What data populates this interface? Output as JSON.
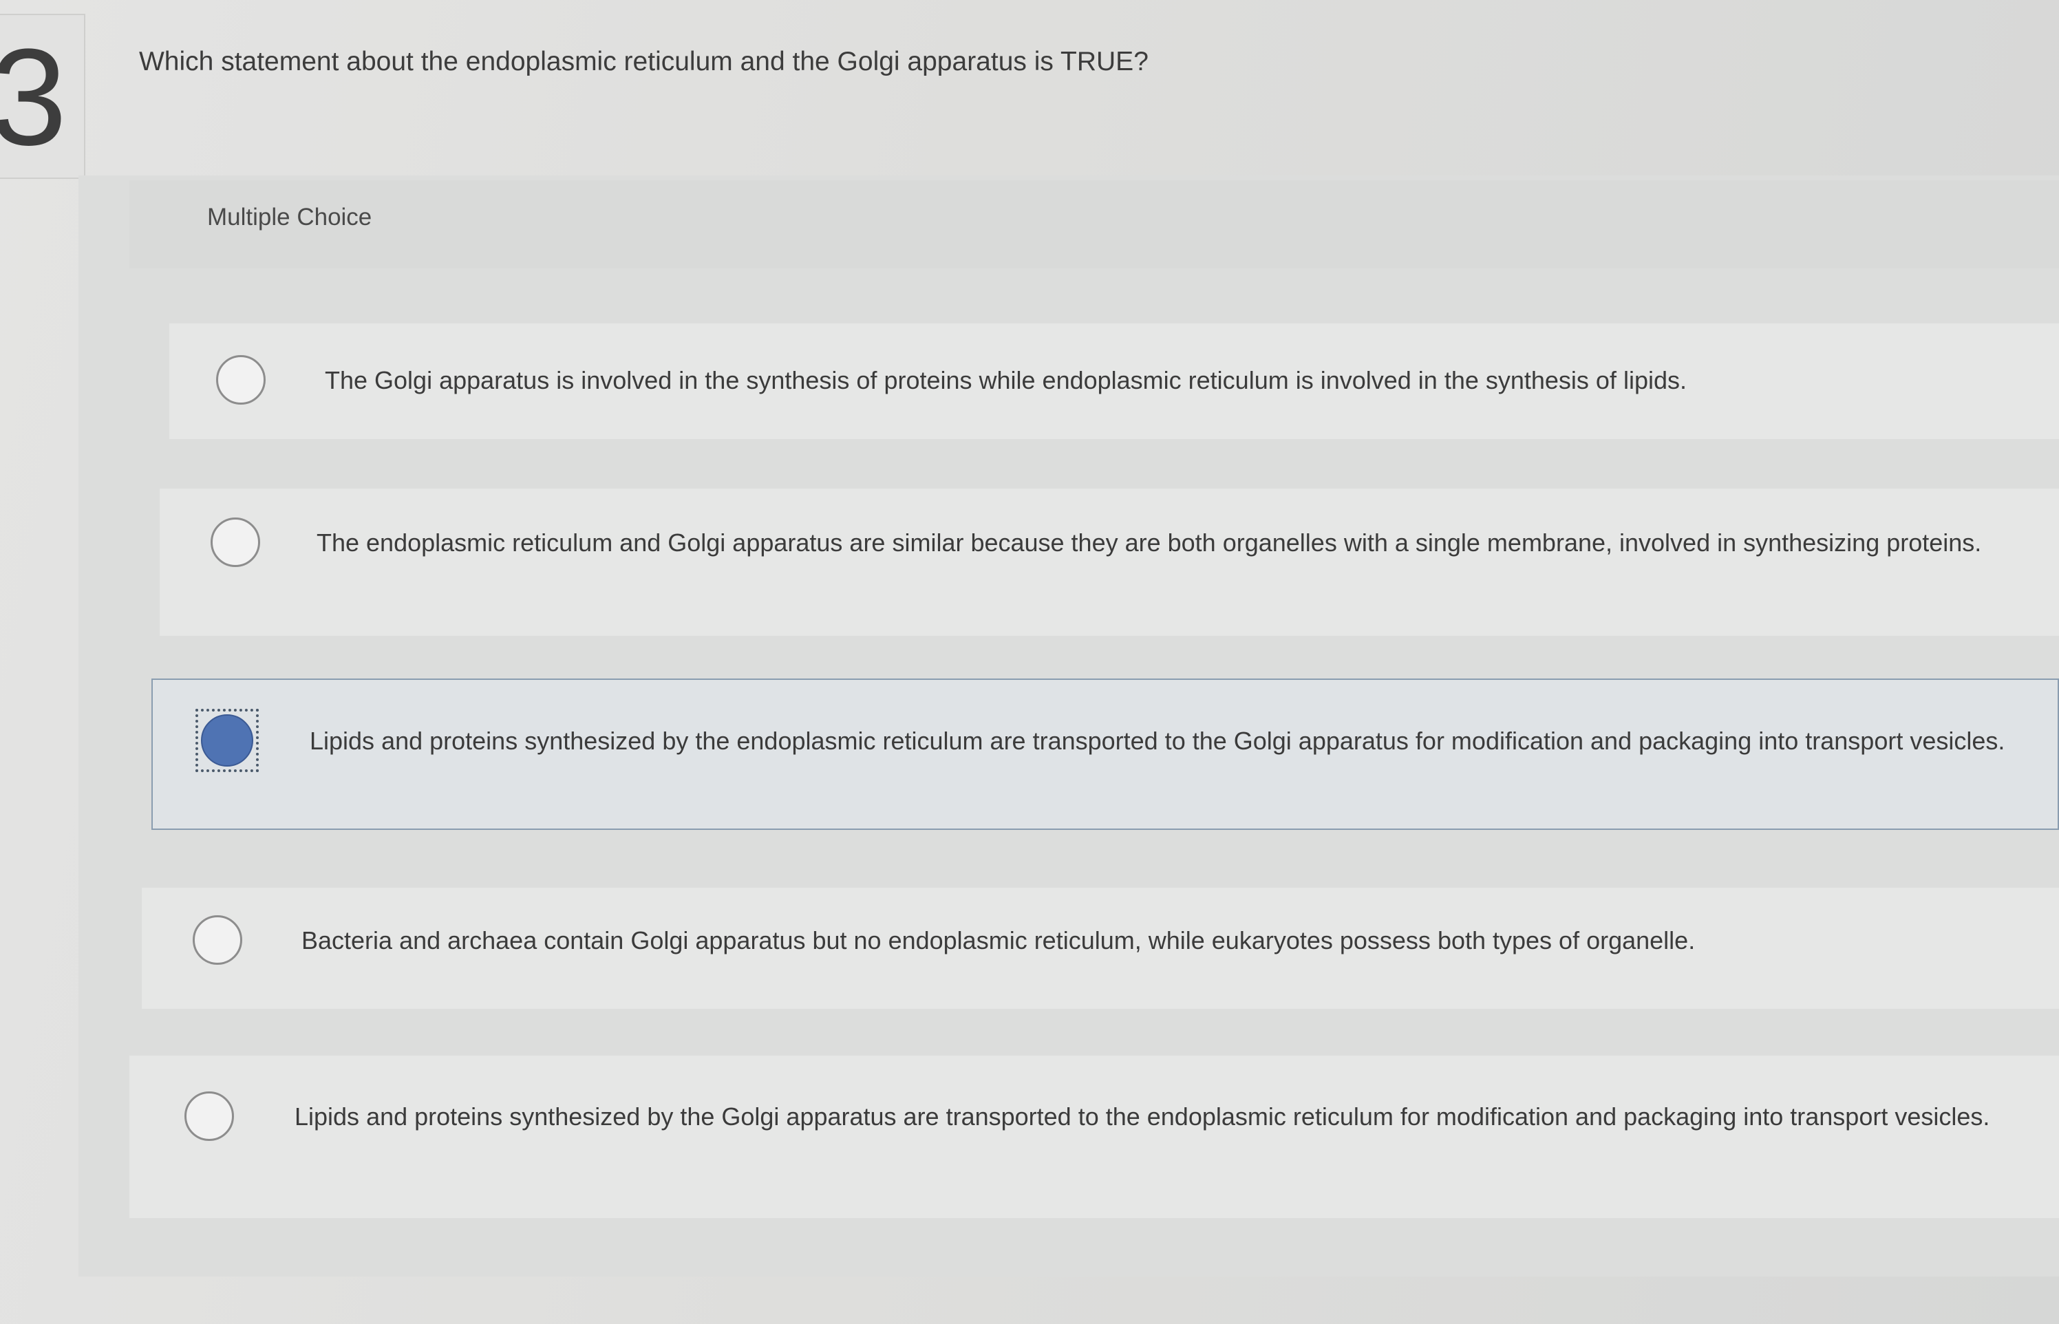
{
  "question": {
    "number": "3",
    "text": "Which statement about the endoplasmic reticulum and the Golgi apparatus is TRUE?"
  },
  "answer_type_label": "Multiple Choice",
  "accent_color": "#4f73b3",
  "options": [
    {
      "text": "The Golgi apparatus is involved in the synthesis of proteins while endoplasmic reticulum is involved in the synthesis of lipids.",
      "selected": false
    },
    {
      "text": "The endoplasmic reticulum and Golgi apparatus are similar because they are both organelles with a single membrane, involved in synthesizing proteins.",
      "selected": false
    },
    {
      "text": "Lipids and proteins synthesized by the endoplasmic reticulum are transported to the Golgi apparatus for modification and packaging into transport vesicles.",
      "selected": true
    },
    {
      "text": "Bacteria and archaea contain Golgi apparatus but no endoplasmic reticulum, while eukaryotes possess both types of organelle.",
      "selected": false
    },
    {
      "text": "Lipids and proteins synthesized by the Golgi apparatus are transported to the endoplasmic reticulum for modification and packaging into transport vesicles.",
      "selected": false
    }
  ]
}
